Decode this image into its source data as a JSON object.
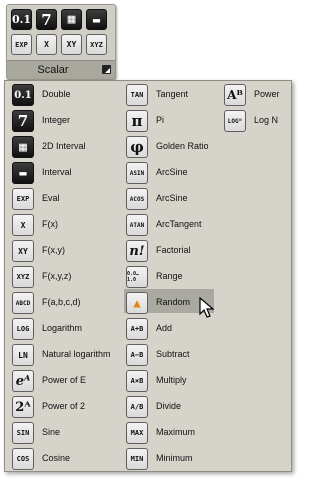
{
  "mini_panel": {
    "title": "Scalar",
    "buttons": [
      {
        "name": "double",
        "glyph": "0.1"
      },
      {
        "name": "integer",
        "glyph": "7"
      },
      {
        "name": "2d-interval",
        "glyph": "▦"
      },
      {
        "name": "interval",
        "glyph": "▬"
      },
      {
        "name": "eval",
        "glyph": "EXP"
      },
      {
        "name": "fx",
        "glyph": "X"
      },
      {
        "name": "fxy",
        "glyph": "XY"
      },
      {
        "name": "fxyz",
        "glyph": "XYZ"
      }
    ]
  },
  "menu": {
    "col1": [
      {
        "label": "Double",
        "icon": "double-icon",
        "glyph": "0.1"
      },
      {
        "label": "Integer",
        "icon": "integer-icon",
        "glyph": "7"
      },
      {
        "label": "2D Interval",
        "icon": "2d-interval-icon",
        "glyph": "▦"
      },
      {
        "label": "Interval",
        "icon": "interval-icon",
        "glyph": "▬"
      },
      {
        "label": "Eval",
        "icon": "eval-icon",
        "glyph": "EXP"
      },
      {
        "label": "F(x)",
        "icon": "fx-icon",
        "glyph": "X"
      },
      {
        "label": "F(x,y)",
        "icon": "fxy-icon",
        "glyph": "XY"
      },
      {
        "label": "F(x,y,z)",
        "icon": "fxyz-icon",
        "glyph": "XYZ"
      },
      {
        "label": "F(a,b,c,d)",
        "icon": "fabcd-icon",
        "glyph": "ABCD"
      },
      {
        "label": "Logarithm",
        "icon": "log-icon",
        "glyph": "LOG"
      },
      {
        "label": "Natural logarithm",
        "icon": "ln-icon",
        "glyph": "LN"
      },
      {
        "label": "Power of E",
        "icon": "power-e-icon",
        "glyph": "eᴬ"
      },
      {
        "label": "Power of 2",
        "icon": "power-2-icon",
        "glyph": "2ᴬ"
      },
      {
        "label": "Sine",
        "icon": "sine-icon",
        "glyph": "SIN"
      },
      {
        "label": "Cosine",
        "icon": "cosine-icon",
        "glyph": "COS"
      }
    ],
    "col2": [
      {
        "label": "Tangent",
        "icon": "tangent-icon",
        "glyph": "TAN"
      },
      {
        "label": "Pi",
        "icon": "pi-icon",
        "glyph": "π"
      },
      {
        "label": "Golden Ratio",
        "icon": "phi-icon",
        "glyph": "φ"
      },
      {
        "label": "ArcSine",
        "icon": "arcsine-icon",
        "glyph": "ASIN"
      },
      {
        "label": "ArcSine",
        "icon": "arccosine-icon",
        "glyph": "ACOS"
      },
      {
        "label": "ArcTangent",
        "icon": "arctangent-icon",
        "glyph": "ATAN"
      },
      {
        "label": "Factorial",
        "icon": "factorial-icon",
        "glyph": "n!"
      },
      {
        "label": "Range",
        "icon": "range-icon",
        "glyph": "0.0…1.0"
      },
      {
        "label": "Random",
        "icon": "random-icon",
        "glyph": "▲"
      },
      {
        "label": "Add",
        "icon": "add-icon",
        "glyph": "A+B"
      },
      {
        "label": "Subtract",
        "icon": "subtract-icon",
        "glyph": "A−B"
      },
      {
        "label": "Multiply",
        "icon": "multiply-icon",
        "glyph": "A×B"
      },
      {
        "label": "Divide",
        "icon": "divide-icon",
        "glyph": "A/B"
      },
      {
        "label": "Maximum",
        "icon": "maximum-icon",
        "glyph": "MAX"
      },
      {
        "label": "Minimum",
        "icon": "minimum-icon",
        "glyph": "MIN"
      }
    ],
    "col3": [
      {
        "label": "Power",
        "icon": "power-icon",
        "glyph": "Aᴮ"
      },
      {
        "label": "Log N",
        "icon": "log-n-icon",
        "glyph": "LOGᴺ"
      }
    ],
    "hovered_item": "Random"
  }
}
